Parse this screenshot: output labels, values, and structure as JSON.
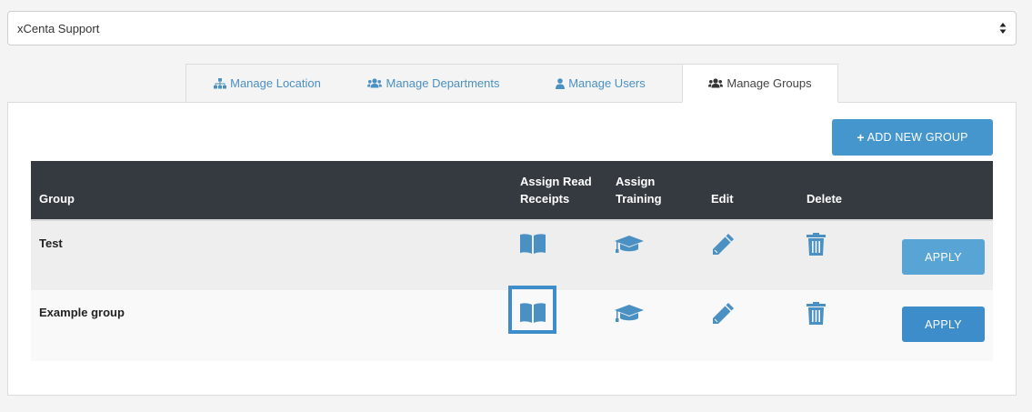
{
  "org_select": {
    "value": "xCenta Support"
  },
  "tabs": [
    {
      "label": "Manage Location",
      "icon": "sitemap-icon"
    },
    {
      "label": "Manage Departments",
      "icon": "users-icon"
    },
    {
      "label": "Manage Users",
      "icon": "user-icon"
    },
    {
      "label": "Manage Groups",
      "icon": "users-icon",
      "active": true
    }
  ],
  "toolbar": {
    "add_label": "ADD NEW GROUP"
  },
  "table": {
    "headers": {
      "group": "Group",
      "assign_read_receipts": "Assign Read Receipts",
      "assign_read_line1": "Assign Read",
      "assign_read_line2": "Receipts",
      "assign_training_line1": "Assign",
      "assign_training_line2": "Training",
      "edit": "Edit",
      "delete": "Delete"
    },
    "rows": [
      {
        "name": "Test",
        "apply_label": "APPLY"
      },
      {
        "name": "Example group",
        "apply_label": "APPLY"
      }
    ]
  },
  "colors": {
    "accent": "#4596cd",
    "header_bg": "#343a40",
    "icon": "#4a90c2"
  }
}
